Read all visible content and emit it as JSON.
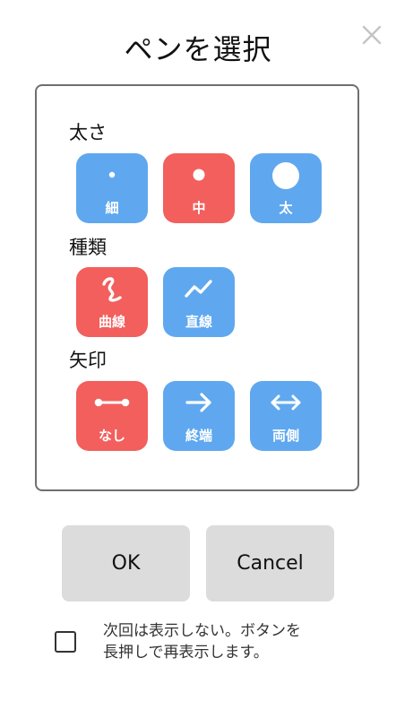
{
  "dialog": {
    "title": "ペンを選択",
    "close_icon": "close-icon"
  },
  "colors": {
    "blue": "#5fa8ef",
    "red": "#f25f5c",
    "button_bg": "#dcdcdc",
    "panel_border": "#6f6f6f"
  },
  "thickness": {
    "label": "太さ",
    "selected": "中",
    "options": [
      {
        "label": "細",
        "icon": "small-dot-icon",
        "selected": false
      },
      {
        "label": "中",
        "icon": "medium-dot-icon",
        "selected": true
      },
      {
        "label": "太",
        "icon": "large-dot-icon",
        "selected": false
      }
    ]
  },
  "type": {
    "label": "種類",
    "selected": "曲線",
    "options": [
      {
        "label": "曲線",
        "icon": "curve-icon",
        "selected": true
      },
      {
        "label": "直線",
        "icon": "zigzag-line-icon",
        "selected": false
      }
    ]
  },
  "arrow": {
    "label": "矢印",
    "selected": "なし",
    "options": [
      {
        "label": "なし",
        "icon": "no-arrow-line-icon",
        "selected": true
      },
      {
        "label": "終端",
        "icon": "right-arrow-icon",
        "selected": false
      },
      {
        "label": "両側",
        "icon": "double-arrow-icon",
        "selected": false
      }
    ]
  },
  "buttons": {
    "ok": "OK",
    "cancel": "Cancel"
  },
  "dont_show": {
    "checked": false,
    "line1": "次回は表示しない。ボタンを",
    "line2": "長押しで再表示します。"
  }
}
